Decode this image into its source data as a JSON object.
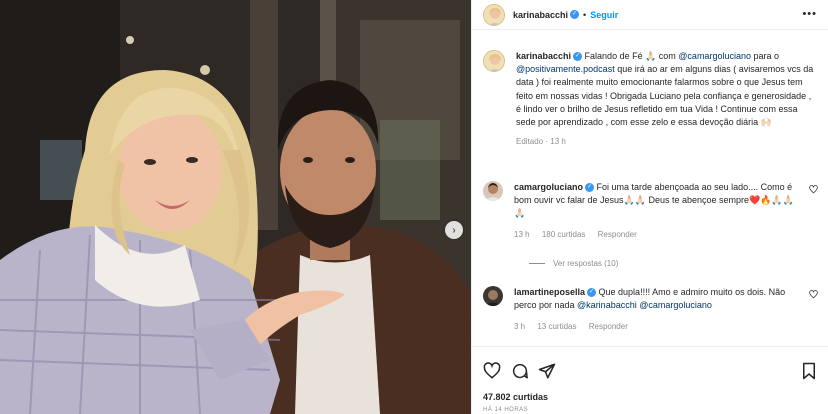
{
  "header": {
    "username": "karinabacchi",
    "follow_label": "Seguir"
  },
  "caption": {
    "username": "karinabacchi",
    "text_1": "Falando de Fé 🙏🏻 com ",
    "mention_1": "@camargoluciano",
    "text_2": " para o ",
    "mention_2": "@positivamente.podcast",
    "text_3": " que irá ao ar em alguns dias ( avisaremos vcs da data ) foi realmente muito emocionante falarmos sobre o que Jesus tem feito em nossas vidas ! Obrigada Luciano pela confiança e generosidade , é lindo ver o brilho de Jesus refletido em tua Vida ! Continue com essa sede por aprendizado , com esse zelo e essa devoção diária 🙌🏻",
    "edited": "Editado",
    "time": "13 h"
  },
  "comments": [
    {
      "username": "camargoluciano",
      "text": " Foi uma tarde abençoada ao seu lado.... Como é bom ouvir vc falar de Jesus🙏🏻🙏🏻 Deus te abençoe sempre❤️🔥🙏🏻🙏🏻🙏🏻",
      "time": "13 h",
      "likes": "180 curtidas",
      "reply": "Responder"
    },
    {
      "username": "lamartineposella",
      "text_1": " Que dupla!!!! Amo e admiro muito os dois. Não perco por nada ",
      "mention_1": "@karinabacchi",
      "mention_2": "@camargoluciano",
      "time": "3 h",
      "likes": "13 curtidas",
      "reply": "Responder"
    }
  ],
  "replies_label": "Ver respostas (10)",
  "likes_total": "47.802 curtidas",
  "posted": "HÁ 14 HORAS",
  "icons": {
    "more": "more-icon",
    "heart": "heart-icon",
    "comment": "comment-icon",
    "share": "share-icon",
    "save": "bookmark-icon",
    "next": "chevron-right-icon"
  },
  "colors": {
    "link": "#0095f6",
    "mention": "#00376b",
    "verified": "#3897f0",
    "muted": "#8e8e8e"
  }
}
